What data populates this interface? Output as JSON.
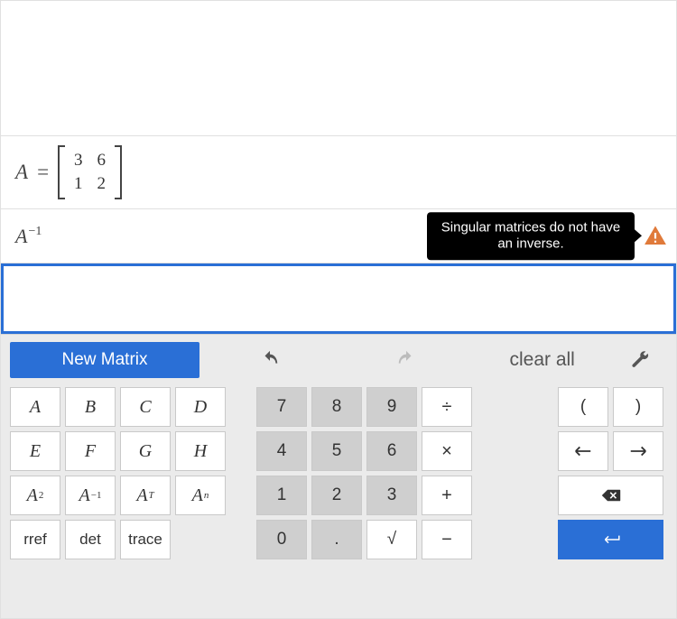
{
  "history": {
    "def": {
      "label": "A",
      "eq": "=",
      "matrix": [
        [
          "3",
          "6"
        ],
        [
          "1",
          "2"
        ]
      ]
    },
    "expr": {
      "base": "A",
      "exp": "−1"
    },
    "error_tooltip": "Singular matrices do not have an inverse."
  },
  "toolbar": {
    "new_matrix": "New Matrix",
    "clear_all": "clear all"
  },
  "keys": {
    "letters": [
      "A",
      "B",
      "C",
      "D",
      "E",
      "F",
      "G",
      "H"
    ],
    "ops_row": {
      "sq": "2",
      "inv": "−1",
      "tr": "T",
      "pn": "n"
    },
    "funcs": {
      "rref": "rref",
      "det": "det",
      "trace": "trace"
    },
    "digits": {
      "d7": "7",
      "d8": "8",
      "d9": "9",
      "div": "÷",
      "d4": "4",
      "d5": "5",
      "d6": "6",
      "mul": "×",
      "d1": "1",
      "d2": "2",
      "d3": "3",
      "add": "+",
      "d0": "0",
      "dot": ".",
      "sqrt": "√",
      "sub": "−"
    },
    "right": {
      "lp": "(",
      "rp": ")"
    }
  }
}
